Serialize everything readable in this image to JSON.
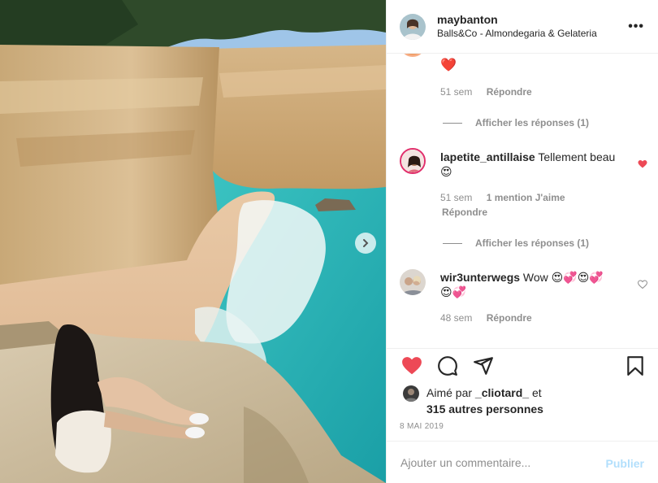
{
  "post": {
    "username": "maybanton",
    "location": "Balls&Co - Almondegaria & Gelateria",
    "more_icon": "more-horizontal-icon"
  },
  "comments": [
    {
      "text_emoji": "❤️",
      "time": "51 sem",
      "reply_label": "Répondre",
      "view_replies": "Afficher les réponses (1)"
    },
    {
      "username": "lapetite_antillaise",
      "text": "Tellement beau",
      "emoji": "😍",
      "time": "51 sem",
      "likes": "1 mention J'aime",
      "reply_label": "Répondre",
      "view_replies": "Afficher les réponses (1)",
      "liked": true
    },
    {
      "username": "wir3unterwegs",
      "text": "Wow",
      "emoji_line1": "😍💞😍💞",
      "emoji_line2": "😍💞",
      "time": "48 sem",
      "reply_label": "Répondre",
      "liked": false
    }
  ],
  "actions": {
    "like_icon": "heart-filled-icon",
    "comment_icon": "comment-icon",
    "share_icon": "share-icon",
    "save_icon": "bookmark-icon",
    "liked": true
  },
  "likes": {
    "prefix": "Aimé par",
    "user": "_cliotard_",
    "joiner": "et",
    "others": "315 autres personnes"
  },
  "date": "8 MAI 2019",
  "add_comment": {
    "placeholder": "Ajouter un commentaire...",
    "publish_label": "Publier"
  },
  "colors": {
    "like_red": "#ed4956",
    "text": "#262626",
    "muted": "#8e8e8e",
    "publish_disabled": "#b2dffc"
  }
}
